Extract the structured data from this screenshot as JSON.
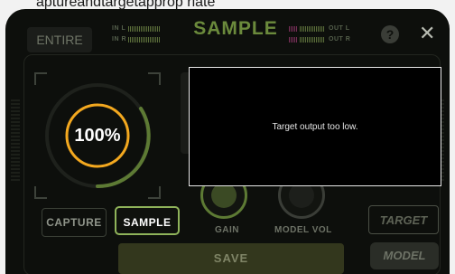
{
  "headline": "aptureandtargetapprop riate",
  "header": {
    "mode_button": "ENTIRE",
    "title": "SAMPLE",
    "input_left_label": "IN L",
    "input_right_label": "IN R",
    "output_left_label": "OUT L",
    "output_right_label": "OUT R",
    "help_glyph": "?",
    "close_glyph": "✕"
  },
  "meter": {
    "percent_text": "100%",
    "percent_value": 100,
    "ring_color": "#f3a81f",
    "arc_color": "#5d7a34"
  },
  "controls": {
    "capture_label": "CAPTURE",
    "sample_label": "SAMPLE",
    "gain_label": "GAIN",
    "model_vol_label": "MODEL VOL",
    "target_label": "TARGET",
    "model_label": "MODEL",
    "save_label": "SAVE"
  },
  "dialog": {
    "message": "Target output too low."
  },
  "colors": {
    "accent_green": "#8fb35a",
    "panel_bg": "#0d0f0c"
  }
}
